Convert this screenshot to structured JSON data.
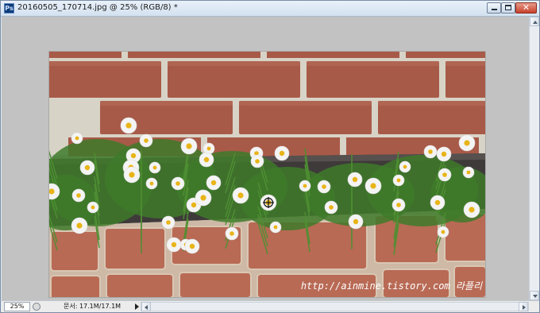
{
  "window": {
    "title": "20160505_170714.jpg @ 25% (RGB/8) *",
    "app_icon_glyph": "Ps",
    "close_glyph": "✕",
    "controls": [
      "minimize",
      "maximize",
      "close"
    ]
  },
  "document": {
    "watermark": "http://ainmine.tistory.com 라플리"
  },
  "statusbar": {
    "zoom": "25%",
    "doc_info": "문서: 17.1M/17.1M"
  },
  "colors": {
    "canvas_bg": "#c2c2c2",
    "brick": "#a85a48",
    "mortar": "#d8d3c7",
    "dark_stone": "#3f3a3a",
    "paver": "#b86a55",
    "daisy_petal": "#ffffff",
    "daisy_center": "#e8b418",
    "foliage": "#3e7a2a"
  },
  "icons": {
    "app": "photoshop-icon",
    "cursor": "crosshair-cursor-icon"
  }
}
